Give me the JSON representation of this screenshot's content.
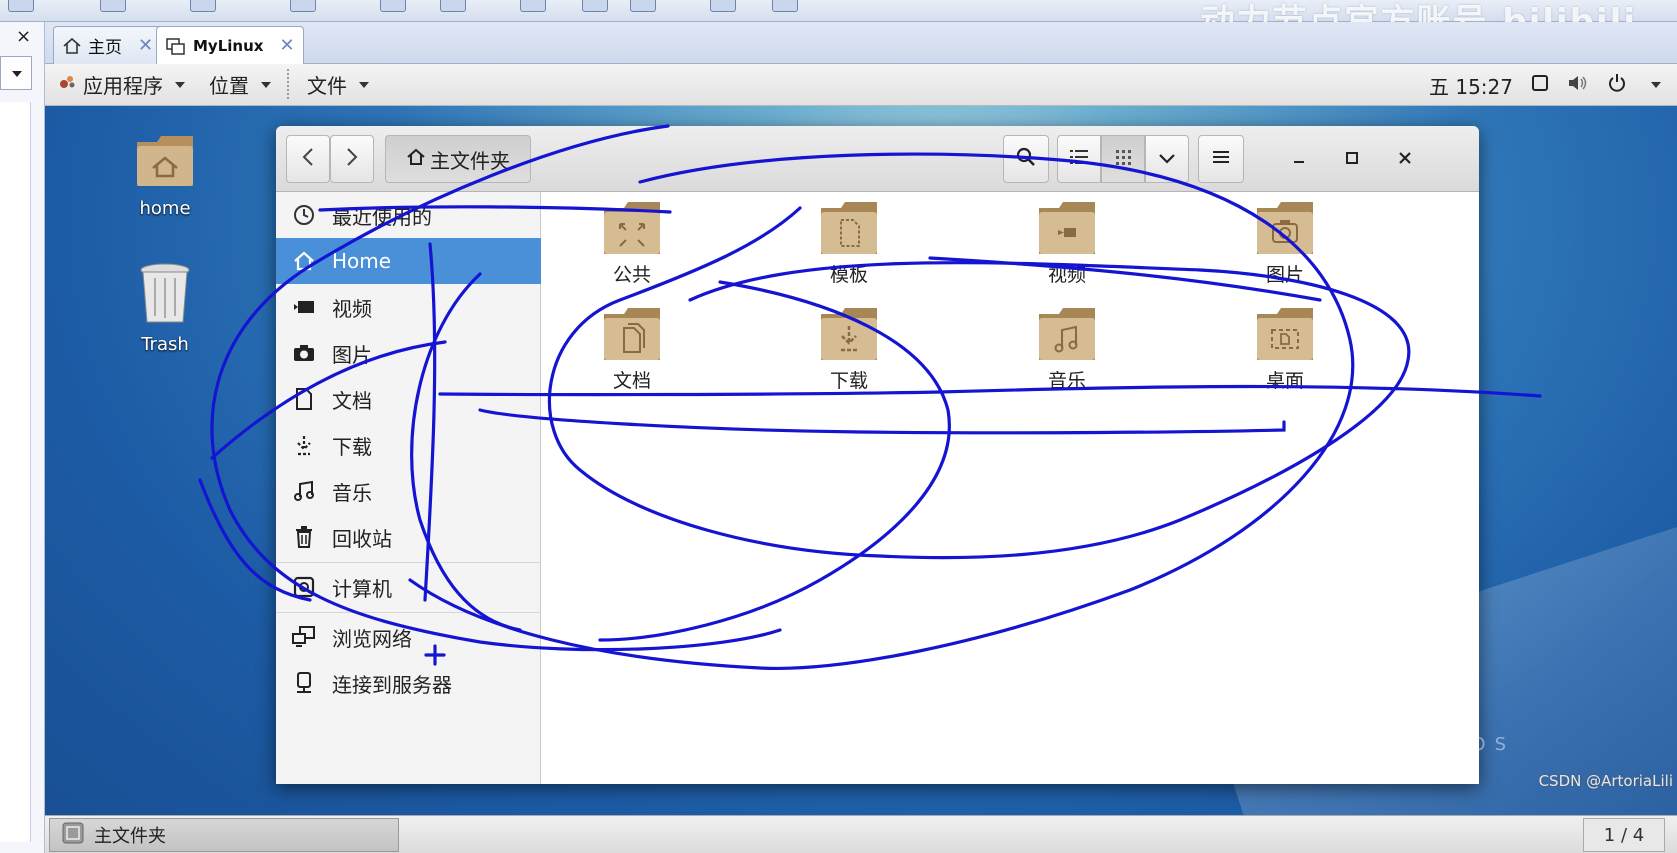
{
  "host": {
    "watermark": "动力节点官方账号 bilibili",
    "tabs": [
      {
        "label": "主页",
        "icon": "home-icon"
      },
      {
        "label": "MyLinux",
        "icon": "vm-icon"
      }
    ],
    "close_glyph": "×"
  },
  "guest_panel": {
    "applications": "应用程序",
    "places": "位置",
    "files": "文件",
    "clock": "五 15:27"
  },
  "desktop": {
    "icons": [
      {
        "label": "home",
        "icon": "home-folder-icon"
      },
      {
        "label": "Trash",
        "icon": "trash-icon"
      }
    ]
  },
  "file_manager": {
    "path": "主文件夹",
    "sidebar": [
      {
        "label": "最近使用的",
        "icon": "recent-icon"
      },
      {
        "label": "Home",
        "icon": "home-icon",
        "selected": true
      },
      {
        "label": "视频",
        "icon": "video-icon"
      },
      {
        "label": "图片",
        "icon": "camera-icon"
      },
      {
        "label": "文档",
        "icon": "document-icon"
      },
      {
        "label": "下载",
        "icon": "download-icon"
      },
      {
        "label": "音乐",
        "icon": "music-icon"
      },
      {
        "label": "回收站",
        "icon": "trash-icon"
      },
      {
        "label": "计算机",
        "icon": "computer-icon"
      },
      {
        "label": "浏览网络",
        "icon": "network-icon"
      },
      {
        "label": "连接到服务器",
        "icon": "server-icon"
      }
    ],
    "folders": [
      {
        "label": "公共",
        "icon": "share-folder-icon"
      },
      {
        "label": "模板",
        "icon": "template-folder-icon"
      },
      {
        "label": "视频",
        "icon": "video-folder-icon"
      },
      {
        "label": "图片",
        "icon": "picture-folder-icon"
      },
      {
        "label": "文档",
        "icon": "document-folder-icon"
      },
      {
        "label": "下载",
        "icon": "download-folder-icon"
      },
      {
        "label": "音乐",
        "icon": "music-folder-icon"
      },
      {
        "label": "桌面",
        "icon": "desktop-folder-icon"
      }
    ]
  },
  "bottom_panel": {
    "task": "主文件夹",
    "pager": "1 / 4"
  },
  "overlays": {
    "centos": "CENTOS",
    "csdn": "CSDN @ArtoriaLili"
  },
  "colors": {
    "selection": "#4a90d9",
    "folder": "#c9ad87",
    "scribble": "#1414d2"
  }
}
